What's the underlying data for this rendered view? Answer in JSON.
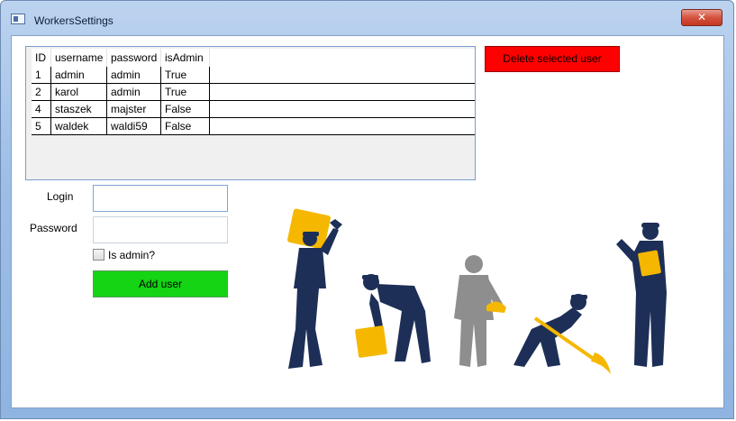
{
  "window": {
    "title": "WorkersSettings",
    "close_glyph": "✕"
  },
  "grid": {
    "columns": [
      "ID",
      "username",
      "password",
      "isAdmin"
    ],
    "rows": [
      [
        "1",
        "admin",
        "admin",
        "True"
      ],
      [
        "2",
        "karol",
        "admin",
        "True"
      ],
      [
        "4",
        "staszek",
        "majster",
        "False"
      ],
      [
        "5",
        "waldek",
        "waldi59",
        "False"
      ]
    ]
  },
  "buttons": {
    "delete_label": "Delete selected user",
    "add_label": "Add user"
  },
  "form": {
    "login_label": "Login",
    "login_value": "",
    "password_label": "Password",
    "password_value": "",
    "is_admin_label": "Is admin?",
    "is_admin_checked": false
  },
  "colors": {
    "delete_button": "#ff0000",
    "add_button": "#14d414",
    "worker_navy": "#1d2f57",
    "worker_gray": "#8e8e8e",
    "worker_yellow": "#f5b700"
  }
}
